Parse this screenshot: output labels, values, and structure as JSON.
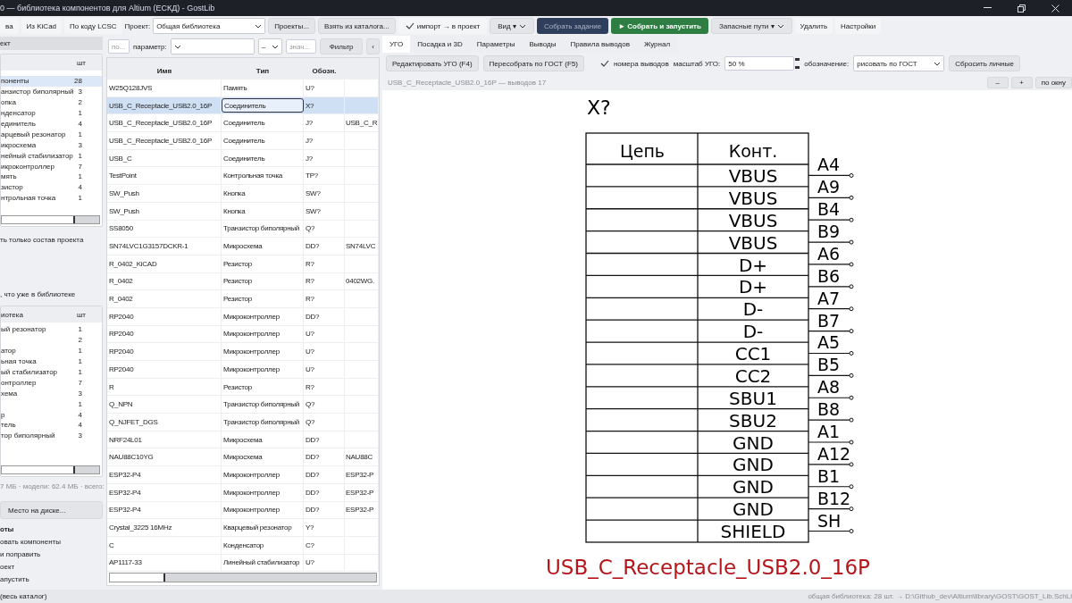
{
  "window": {
    "title": "0 — библиотека компонентов для Altium (ЕСКД) - GostLib"
  },
  "toolbar": [
    {
      "kind": "button",
      "label": "ва"
    },
    {
      "kind": "button",
      "label": "Из KiCad"
    },
    {
      "kind": "button",
      "label": "По коду LCSC"
    },
    {
      "kind": "combo",
      "label": "Проект:",
      "value": "Общая библиотека"
    },
    {
      "kind": "raised",
      "label": "Проекты..."
    },
    {
      "kind": "raised",
      "label": "Взять из каталога..."
    },
    {
      "kind": "check",
      "label": "импорт → в проект",
      "checked": true
    },
    {
      "kind": "menu",
      "label": "Вид ▾"
    },
    {
      "kind": "dark",
      "label": "Собрать задание"
    },
    {
      "kind": "green",
      "label": "► Собрать и запустить"
    },
    {
      "kind": "menu",
      "label": "Запасные пути ▾"
    },
    {
      "kind": "button",
      "label": "Удалить"
    },
    {
      "kind": "button",
      "label": "Настройки"
    }
  ],
  "left": {
    "header": "ект",
    "groups": {
      "count_header": "шт",
      "rows": [
        {
          "name": "поненты",
          "count": "28",
          "selected": true
        },
        {
          "name": "анзистор биполярный",
          "count": "3",
          "selected": false
        },
        {
          "name": "опка",
          "count": "2",
          "selected": false
        },
        {
          "name": "нденсатор",
          "count": "1",
          "selected": false
        },
        {
          "name": "единитель",
          "count": "4",
          "selected": false
        },
        {
          "name": "арцевый резонатор",
          "count": "1",
          "selected": false
        },
        {
          "name": "икросхема",
          "count": "3",
          "selected": false
        },
        {
          "name": "нейный стабилизатор",
          "count": "1",
          "selected": false
        },
        {
          "name": "икроконтроллер",
          "count": "7",
          "selected": false
        },
        {
          "name": "мять",
          "count": "1",
          "selected": false
        },
        {
          "name": "зистор",
          "count": "4",
          "selected": false
        },
        {
          "name": "нтрольная точка",
          "count": "1",
          "selected": false
        }
      ]
    },
    "only_project": "ть только состав проекта",
    "in_library": ", что уже в библиотеке",
    "library": {
      "header": "иотека",
      "count_header": "шт",
      "rows": [
        {
          "name": "ый резонатор",
          "count": "1"
        },
        {
          "count": "2"
        },
        {
          "name": "атор",
          "count": "1"
        },
        {
          "name": "ьная точка",
          "count": "1"
        },
        {
          "name": "ый стабилизатор",
          "count": "1"
        },
        {
          "name": "онтроллер",
          "count": "7"
        },
        {
          "name": "хема",
          "count": "3"
        },
        {
          "count": "1"
        },
        {
          "name": "р",
          "count": "4"
        },
        {
          "name": "тель",
          "count": "4"
        },
        {
          "name": "тор биполярный",
          "count": "3"
        }
      ]
    },
    "disk_info": "7 МБ · модели: 62.4 МБ · всего:",
    "disk_button": "Место на диске...",
    "steps_title": "оты",
    "steps": [
      "овать компоненты",
      "и поправить",
      "оект",
      "апустить"
    ]
  },
  "filter": {
    "search_placeholder": "по...",
    "param_label": "параметр:",
    "op": "–",
    "value_placeholder": "знач...",
    "button": "Фильтр",
    "collapse": "‹"
  },
  "table": {
    "columns": [
      "Имя",
      "Тип",
      "Обозн."
    ],
    "rows": [
      {
        "name": "W25Q128JVS",
        "type": "Память",
        "designator": "U?",
        "selected": false
      },
      {
        "name": "USB_C_Receptacle_USB2.0_16P",
        "type": "Соединитель",
        "designator": "X?",
        "selected": true
      },
      {
        "name": "USB_C_Receptacle_USB2.0_16P",
        "type": "Соединитель",
        "designator": "J?",
        "column_4": "USB_C_R",
        "selected": false
      },
      {
        "name": "USB_C_Receptacle_USB2.0_16P",
        "type": "Соединитель",
        "designator": "J?",
        "selected": false
      },
      {
        "name": "USB_C",
        "type": "Соединитель",
        "designator": "J?",
        "selected": false
      },
      {
        "name": "TestPoint",
        "type": "Контрольная точка",
        "designator": "TP?",
        "selected": false
      },
      {
        "name": "SW_Push",
        "type": "Кнопка",
        "designator": "SW?",
        "selected": false
      },
      {
        "name": "SW_Push",
        "type": "Кнопка",
        "designator": "SW?",
        "selected": false
      },
      {
        "name": "SS8050",
        "type": "Транзистор биполярный",
        "designator": "Q?",
        "selected": false
      },
      {
        "name": "SN74LVC1G3157DCKR-1",
        "type": "Микросхема",
        "designator": "DD?",
        "column_4": "SN74LVC",
        "selected": false
      },
      {
        "name": "R_0402_KiCAD",
        "type": "Резистор",
        "designator": "R?",
        "selected": false
      },
      {
        "name": "R_0402",
        "type": "Резистор",
        "designator": "R?",
        "column_4": "0402WG.",
        "selected": false
      },
      {
        "name": "R_0402",
        "type": "Резистор",
        "designator": "R?",
        "selected": false
      },
      {
        "name": "RP2040",
        "type": "Микроконтроллер",
        "designator": "DD?",
        "selected": false
      },
      {
        "name": "RP2040",
        "type": "Микроконтроллер",
        "designator": "U?",
        "selected": false
      },
      {
        "name": "RP2040",
        "type": "Микроконтроллер",
        "designator": "U?",
        "selected": false
      },
      {
        "name": "RP2040",
        "type": "Микроконтроллер",
        "designator": "U?",
        "selected": false
      },
      {
        "name": "R",
        "type": "Резистор",
        "designator": "R?",
        "selected": false
      },
      {
        "name": "Q_NPN",
        "type": "Транзистор биполярный",
        "designator": "Q?",
        "selected": false
      },
      {
        "name": "Q_NJFET_DGS",
        "type": "Транзистор биполярный",
        "designator": "Q?",
        "selected": false
      },
      {
        "name": "NRF24L01",
        "type": "Микросхема",
        "designator": "DD?",
        "selected": false
      },
      {
        "name": "NAU88C10YG",
        "type": "Микросхема",
        "designator": "DD?",
        "column_4": "NAU88C",
        "selected": false
      },
      {
        "name": "ESP32-P4",
        "type": "Микроконтроллер",
        "designator": "DD?",
        "column_4": "ESP32-P",
        "selected": false
      },
      {
        "name": "ESP32-P4",
        "type": "Микроконтроллер",
        "designator": "DD?",
        "column_4": "ESP32-P",
        "selected": false
      },
      {
        "name": "ESP32-P4",
        "type": "Микроконтроллер",
        "designator": "DD?",
        "column_4": "ESP32-P",
        "selected": false
      },
      {
        "name": "Crystal_3225 16MHz",
        "type": "Кварцевый резонатор",
        "designator": "Y?",
        "selected": false
      },
      {
        "name": "C",
        "type": "Конденсатор",
        "designator": "C?",
        "selected": false
      },
      {
        "name": "AP1117-33",
        "type": "Линейный стабилизатор",
        "designator": "U?",
        "selected": false
      }
    ]
  },
  "tabs": [
    {
      "label": "УГО",
      "selected": true
    },
    {
      "label": "Посадка и 3D",
      "selected": false
    },
    {
      "label": "Параметры",
      "selected": false
    },
    {
      "label": "Выводы",
      "selected": false
    },
    {
      "label": "Правила выводов",
      "selected": false
    },
    {
      "label": "Журнал",
      "selected": false
    }
  ],
  "ugo_toolbar": {
    "edit": "Редактировать УГО (F4)",
    "rebuild": "Пересобрать по ГОСТ (F5)",
    "pin_numbers": {
      "label": "номера выводов",
      "checked": true
    },
    "scale_label": "масштаб УГО:",
    "scale": "50 %",
    "designation_label": "обозначение:",
    "designation": "рисовать по ГОСТ",
    "reset": "Сбросить личные"
  },
  "info": "USB_C_Receptacle_USB2.0_16P — выводов 17",
  "zoom": [
    "–",
    "+",
    "по окну"
  ],
  "symbol": {
    "designator": "X?",
    "headers": [
      "Цепь",
      "Конт."
    ],
    "pins": [
      {
        "contact": "VBUS",
        "number": "A4"
      },
      {
        "contact": "VBUS",
        "number": "A9"
      },
      {
        "contact": "VBUS",
        "number": "B4"
      },
      {
        "contact": "VBUS",
        "number": "B9"
      },
      {
        "contact": "D+",
        "number": "A6"
      },
      {
        "contact": "D+",
        "number": "B6"
      },
      {
        "contact": "D-",
        "number": "A7"
      },
      {
        "contact": "D-",
        "number": "B7"
      },
      {
        "contact": "CC1",
        "number": "A5"
      },
      {
        "contact": "CC2",
        "number": "B5"
      },
      {
        "contact": "SBU1",
        "number": "A8"
      },
      {
        "contact": "SBU2",
        "number": "B8"
      },
      {
        "contact": "GND",
        "number": "A1"
      },
      {
        "contact": "GND",
        "number": "A12"
      },
      {
        "contact": "GND",
        "number": "B1"
      },
      {
        "contact": "GND",
        "number": "B12"
      },
      {
        "contact": "SHIELD",
        "number": "SH"
      }
    ],
    "name": "USB_C_Receptacle_USB2.0_16P"
  },
  "status": {
    "left": "(весь каталог)",
    "right": "общая библиотека: 28 шт. → D:\\Github_dev\\Altium\\library\\GOST\\GOST_Lib.SchLi"
  }
}
